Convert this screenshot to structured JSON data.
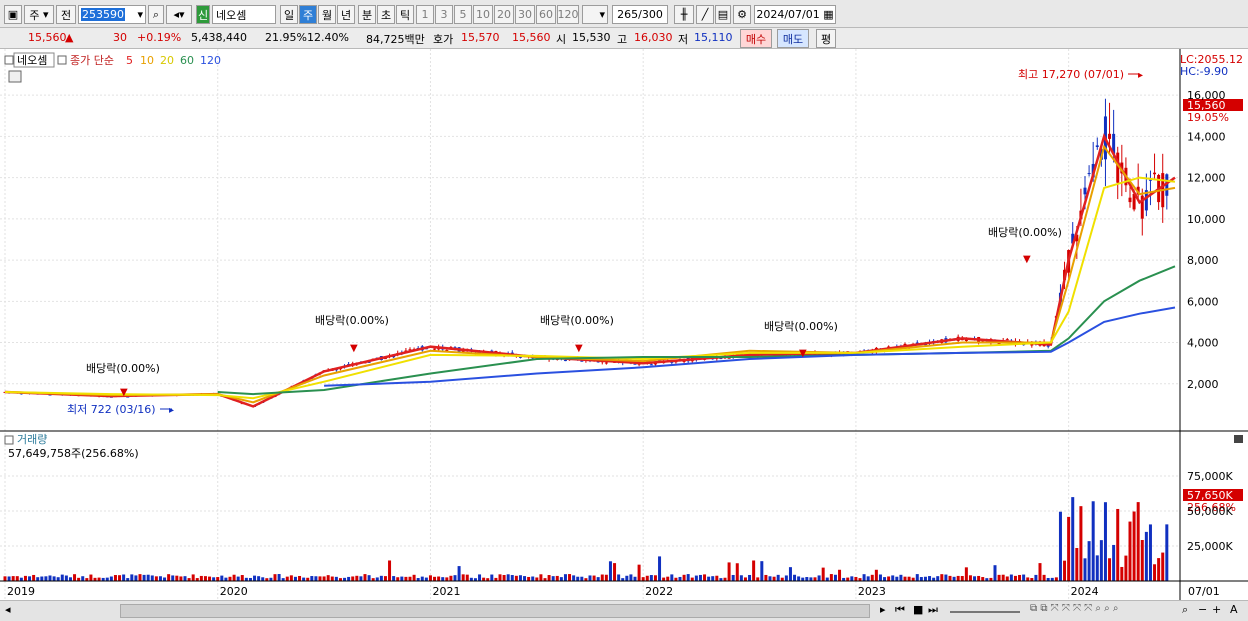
{
  "toolbar": {
    "market_label": "주",
    "prev_label": "전",
    "code_value": "253590",
    "badge_new": "신",
    "stock_name": "네오셈",
    "periods": [
      "일",
      "주",
      "월",
      "년",
      "분",
      "초",
      "틱"
    ],
    "active_period": "주",
    "ranges": [
      "1",
      "3",
      "5",
      "10",
      "20",
      "30",
      "60",
      "120"
    ],
    "count_value": "265",
    "count_total": "/300",
    "date_value": "2024/07/01"
  },
  "infobar": {
    "price": "15,560",
    "change": "30",
    "change_pct": "+0.19%",
    "volume": "5,438,440",
    "volume_ratio": "21.95%",
    "turnover": "12.40%",
    "amount": "84,725백만",
    "bid_label": "호가",
    "ask_price": "15,570",
    "bid_price": "15,560",
    "open_label": "시",
    "open": "15,530",
    "high_label": "고",
    "high": "16,030",
    "low_label": "저",
    "low": "15,110",
    "buy_label": "매수",
    "sell_label": "매도",
    "eval_label": "평"
  },
  "chart": {
    "name": "네오셈",
    "ma_title": "종가 단순",
    "ma_periods": [
      "5",
      "10",
      "20",
      "60",
      "120"
    ],
    "ma_colors": [
      "#e02020",
      "#e8a000",
      "#f0e000",
      "#2a9050",
      "#2a50e0"
    ],
    "lc": "LC:2055.12",
    "hc": "HC:-9.90",
    "high_note": "최고 17,270 (07/01)",
    "low_note": "최저 722 (03/16)",
    "price_tag": "15,560",
    "price_pct": "19.05%",
    "dividend_label": "배당락(0.00%)",
    "y_ticks": [
      "16,000",
      "14,000",
      "12,000",
      "10,000",
      "8,000",
      "6,000",
      "4,000",
      "2,000"
    ],
    "volume_title": "거래량",
    "volume_value": "57,649,758주(256.68%)",
    "vol_ticks": [
      "75,000K",
      "50,000K",
      "25,000K"
    ],
    "vol_tag": "57,650K",
    "vol_pct": "256.68%",
    "x_labels": [
      "2019",
      "2020",
      "2021",
      "2022",
      "2023",
      "2024"
    ],
    "x_end": "07/01"
  },
  "chart_data": {
    "type": "line",
    "title": "",
    "x_range": [
      "2019",
      "2024/07/01"
    ],
    "ylim": [
      0,
      17270
    ],
    "y_ticks": [
      2000,
      4000,
      6000,
      8000,
      10000,
      12000,
      14000,
      16000
    ],
    "x": [
      "2019-01",
      "2019-07",
      "2020-01",
      "2020-03",
      "2020-07",
      "2021-01",
      "2021-07",
      "2022-01",
      "2022-07",
      "2023-01",
      "2023-07",
      "2023-12",
      "2024-01",
      "2024-03",
      "2024-05",
      "2024-07"
    ],
    "series": [
      {
        "name": "5",
        "values": [
          1600,
          1400,
          1500,
          900,
          2600,
          3800,
          3300,
          3000,
          3400,
          3500,
          4200,
          3900,
          8000,
          14000,
          10800,
          12000
        ]
      },
      {
        "name": "10",
        "values": [
          1600,
          1450,
          1500,
          1100,
          2400,
          3600,
          3300,
          3100,
          3600,
          3500,
          4000,
          4000,
          7000,
          13500,
          11200,
          11500
        ]
      },
      {
        "name": "20",
        "values": [
          1600,
          1500,
          1450,
          1300,
          2100,
          3400,
          3350,
          3200,
          3500,
          3500,
          3800,
          4000,
          5500,
          11500,
          12000,
          11800
        ]
      },
      {
        "name": "60",
        "values": [
          null,
          null,
          1600,
          1500,
          1700,
          2500,
          3200,
          3300,
          3300,
          3400,
          3500,
          3600,
          4200,
          6000,
          7000,
          7700
        ]
      },
      {
        "name": "120",
        "values": [
          null,
          null,
          null,
          null,
          1900,
          2100,
          2500,
          2800,
          3200,
          3400,
          3500,
          3550,
          4000,
          5000,
          5400,
          5700
        ]
      }
    ],
    "volume_ylim": [
      0,
      100000
    ],
    "volume_ticks": [
      25000,
      50000,
      75000
    ],
    "annotations": [
      "최고 17,270 (07/01)",
      "최저 722 (03/16)",
      "배당락(0.00%)"
    ],
    "grid": true
  }
}
